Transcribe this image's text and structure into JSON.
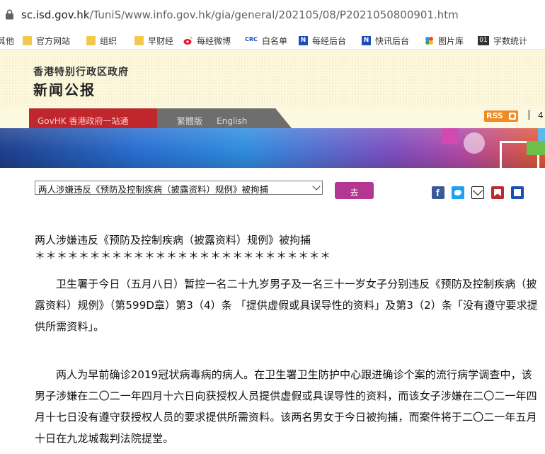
{
  "browser": {
    "url_host": "sc.isd.gov.hk",
    "url_path": "/TuniS/www.info.gov.hk/gia/general/202105/08/P2021050800901.htm"
  },
  "bookmarks": [
    {
      "label": "其他",
      "icon": "none"
    },
    {
      "label": "官方网站",
      "icon": "folder-icon"
    },
    {
      "label": "组织",
      "icon": "folder-icon"
    },
    {
      "label": "早财经",
      "icon": "folder-icon"
    },
    {
      "label": "每经微博",
      "icon": "weibo-icon"
    },
    {
      "label": "白名单",
      "icon": "crc-icon"
    },
    {
      "label": "每经后台",
      "icon": "n-logo-icon"
    },
    {
      "label": "快讯后台",
      "icon": "n-logo-icon"
    },
    {
      "label": "图片库",
      "icon": "photos-icon"
    },
    {
      "label": "字数统计",
      "icon": "01-icon"
    }
  ],
  "bookmark_glyphs": {
    "crc": "CRC",
    "n": "N",
    "zero_one": "01"
  },
  "header": {
    "gov_name": "香港特别行政区政府",
    "site_title": "新闻公报",
    "nav_gov": "GovHK 香港政府一站通",
    "nav_trad": "繁體版",
    "nav_english": "English",
    "rss_label": "RSS",
    "separator": "|",
    "right_char": "4"
  },
  "toolbar": {
    "headline_selected": "两人涉嫌违反《预防及控制疾病（披露资料）规例》被拘捕",
    "go_label": "去"
  },
  "article": {
    "title": "两人涉嫌违反《预防及控制疾病（披露资料）规例》被拘捕",
    "stars": "＊＊＊＊＊＊＊＊＊＊＊＊＊＊＊＊＊＊＊＊＊＊＊＊＊＊＊",
    "paragraph1": "卫生署于今日（五月八日）暂控一名二十九岁男子及一名三十一岁女子分别违反《预防及控制疾病（披露资料）规例》（第599D章）第3（4）条 「提供虚假或具误导性的资料」及第3（2）条「没有遵守要求提供所需资料」。",
    "paragraph2": "两人为早前确诊2019冠状病毒病的病人。在卫生署卫生防护中心跟进确诊个案的流行病学调查中，该男子涉嫌在二〇二一年四月十六日向获授权人员提供虚假或具误导性的资料，而该女子涉嫌在二〇二一年四月十七日没有遵守获授权人员的要求提供所需资料。该两名男女于今日被拘捕，而案件将于二〇二一年五月十日在九龙城裁判法院提堂。"
  },
  "share_icons": [
    "facebook-icon",
    "twitter-icon",
    "email-icon",
    "bookmark-icon",
    "print-icon"
  ],
  "colors": {
    "nav_red": "#c0272d",
    "go_button": "#b53692",
    "rss_orange": "#f08a24"
  }
}
